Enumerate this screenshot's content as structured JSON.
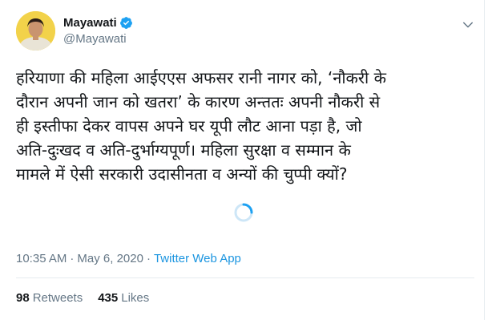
{
  "user": {
    "display_name": "Mayawati",
    "handle": "@Mayawati",
    "verified_icon": "verified-badge-icon",
    "avatar_icon": "avatar"
  },
  "tweet": {
    "text": "हरियाणा की महिला आईएएस अफसर रानी नागर को, ‘नौकरी के\nदौरान अपनी जान को खतरा’ के कारण अन्ततः अपनी नौकरी से\nही इस्तीफा देकर वापस अपने घर यूपी लौट आना पड़ा है, जो\nअति-दुःखद व अति-दुर्भाग्यपूर्ण। महिला सुरक्षा व सम्मान के\nमामले में ऐसी सरकारी उदासीनता व अन्यों की चुप्पी क्यों?"
  },
  "meta": {
    "time": "10:35 AM",
    "separator": "·",
    "date": "May 6, 2020",
    "source": "Twitter Web App"
  },
  "stats": {
    "retweets_count": "98",
    "retweets_label": "Retweets",
    "likes_count": "435",
    "likes_label": "Likes"
  },
  "colors": {
    "text": "#14171a",
    "secondary": "#657786",
    "accent": "#1b95e0",
    "divider": "#e6ecf0"
  },
  "icons": {
    "more": "chevron-down-icon",
    "loading": "loading-spinner-icon"
  }
}
